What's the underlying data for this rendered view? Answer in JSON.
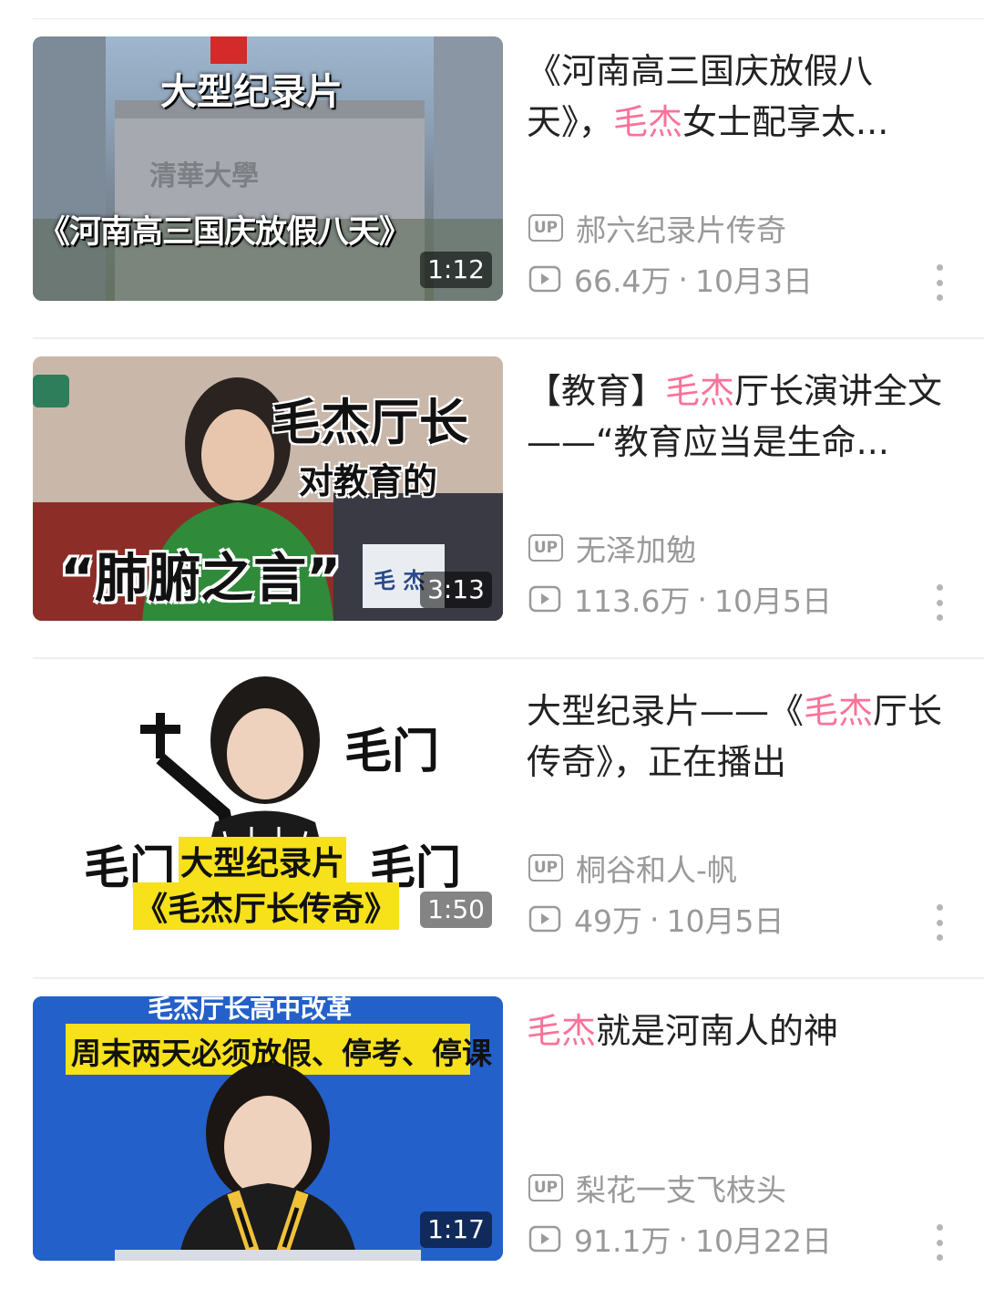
{
  "accent_color": "#fb7299",
  "videos": [
    {
      "title_pre": "《河南高三国庆放假八天》，",
      "title_hl": "毛杰",
      "title_post": "女士配享太...",
      "up_badge": "UP",
      "uploader": "郝六纪录片传奇",
      "views": "66.4万",
      "date": "10月3日",
      "duration": "1:12",
      "thumb_text": [
        "大型纪录片",
        "《河南高三国庆放假八天》",
        "清華大學"
      ]
    },
    {
      "title_pre": "【教育】",
      "title_hl": "毛杰",
      "title_post": "厅长演讲全文——“教育应当是生命...",
      "up_badge": "UP",
      "uploader": "无泽加勉",
      "views": "113.6万",
      "date": "10月5日",
      "duration": "3:13",
      "thumb_text": [
        "毛杰厅长",
        "对教育的",
        "“肺腑之言”",
        "毛 杰"
      ]
    },
    {
      "title_pre": "大型纪录片——《",
      "title_hl": "毛杰",
      "title_post": "厅长传奇》，正在播出",
      "up_badge": "UP",
      "uploader": "桐谷和人-帆",
      "views": "49万",
      "date": "10月5日",
      "duration": "1:50",
      "thumb_text": [
        "毛门",
        "毛门",
        "大型纪录片",
        "毛门",
        "《毛杰厅长传奇》"
      ]
    },
    {
      "title_pre": "",
      "title_hl": "毛杰",
      "title_post": "就是河南人的神",
      "up_badge": "UP",
      "uploader": "梨花一支飞枝头",
      "views": "91.1万",
      "date": "10月22日",
      "duration": "1:17",
      "thumb_text": [
        "毛杰厅长高中改革",
        "周末两天必须放假、停考、停课"
      ]
    }
  ]
}
